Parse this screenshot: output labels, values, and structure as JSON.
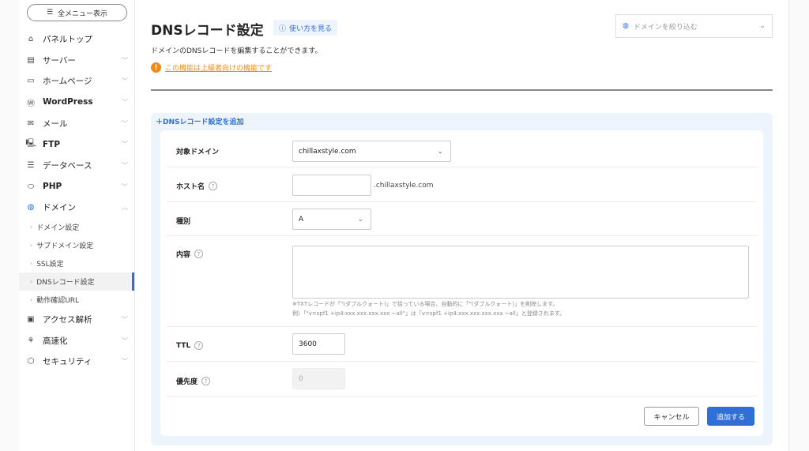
{
  "sidebar": {
    "all_menu": "全メニュー表示",
    "items": [
      {
        "label": "パネルトップ",
        "icon": "home-icon"
      },
      {
        "label": "サーバー",
        "icon": "server-icon"
      },
      {
        "label": "ホームページ",
        "icon": "browser-icon"
      },
      {
        "label": "WordPress",
        "icon": "wordpress-icon"
      },
      {
        "label": "メール",
        "icon": "mail-icon"
      },
      {
        "label": "FTP",
        "icon": "ftp-icon"
      },
      {
        "label": "データベース",
        "icon": "database-icon"
      },
      {
        "label": "PHP",
        "icon": "php-icon"
      },
      {
        "label": "ドメイン",
        "icon": "globe-icon"
      }
    ],
    "sub_items": [
      "ドメイン設定",
      "サブドメイン設定",
      "SSL設定",
      "DNSレコード設定",
      "動作確認URL"
    ],
    "items2": [
      {
        "label": "アクセス解析"
      },
      {
        "label": "高速化"
      },
      {
        "label": "セキュリティ"
      }
    ]
  },
  "header": {
    "title": "DNSレコード設定",
    "howto": "使い方を見る",
    "filter_placeholder": "ドメインを絞り込む",
    "description": "ドメインのDNSレコードを編集することができます。",
    "warning": "この機能は上級者向けの機能です"
  },
  "form": {
    "add_link": "DNSレコード設定を追加",
    "domain_label": "対象ドメイン",
    "domain_value": "chillaxstyle.com",
    "host_label": "ホスト名",
    "host_value": "",
    "host_suffix": ".chillaxstyle.com",
    "type_label": "種別",
    "type_value": "A",
    "content_label": "内容",
    "content_value": "",
    "note1": "※TXTレコードが「\"(ダブルクォート)」で括っている場合、自動的に「\"(ダブルクォート)」を削除します。",
    "note2": "例）「\"v=spf1 +ip4:xxx.xxx.xxx.xxx ~all\"」は「v=spf1 +ip4:xxx.xxx.xxx.xxx ~all」と登録されます。",
    "ttl_label": "TTL",
    "ttl_value": "3600",
    "priority_label": "優先度",
    "priority_value": "0",
    "cancel": "キャンセル",
    "submit": "追加する"
  },
  "colors": {
    "accent": "#2f6fd6",
    "warning": "#f08a1c"
  }
}
